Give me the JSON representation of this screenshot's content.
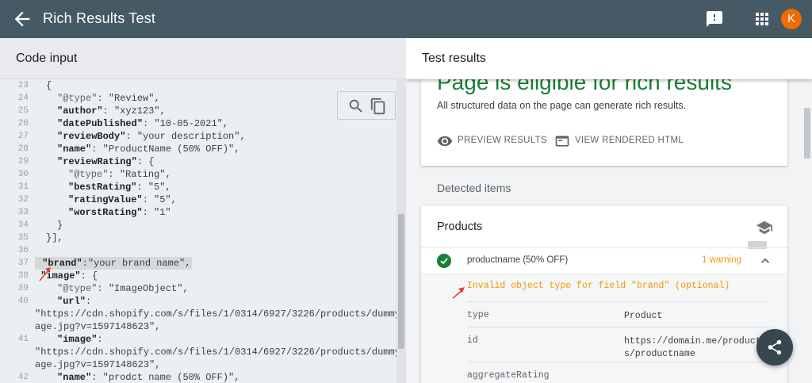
{
  "app": {
    "title": "Rich Results Test",
    "avatar_letter": "K",
    "icons": {
      "back": "arrow-back-icon",
      "feedback": "feedback-icon",
      "apps": "apps-grid-icon"
    }
  },
  "left_panel": {
    "title": "Code input",
    "tools": [
      "search-icon",
      "copy-icon"
    ],
    "lines": [
      {
        "n": "23",
        "indent": 2,
        "parts": [
          [
            "p",
            "{"
          ]
        ]
      },
      {
        "n": "24",
        "indent": 3,
        "parts": [
          [
            "t",
            "\"@type\""
          ],
          [
            "p",
            ": "
          ],
          [
            "s",
            "\"Review\","
          ]
        ]
      },
      {
        "n": "25",
        "indent": 3,
        "parts": [
          [
            "k",
            "\"author\""
          ],
          [
            "p",
            ": "
          ],
          [
            "s",
            "\"xyz123\","
          ]
        ]
      },
      {
        "n": "26",
        "indent": 3,
        "parts": [
          [
            "k",
            "\"datePublished\""
          ],
          [
            "p",
            ": "
          ],
          [
            "s",
            "\"10-05-2021\","
          ]
        ]
      },
      {
        "n": "27",
        "indent": 3,
        "parts": [
          [
            "k",
            "\"reviewBody\""
          ],
          [
            "p",
            ": "
          ],
          [
            "s",
            "\"your description\","
          ]
        ]
      },
      {
        "n": "28",
        "indent": 3,
        "parts": [
          [
            "k",
            "\"name\""
          ],
          [
            "p",
            ": "
          ],
          [
            "s",
            "\"ProductName (50% OFF)\","
          ]
        ]
      },
      {
        "n": "29",
        "indent": 3,
        "parts": [
          [
            "k",
            "\"reviewRating\""
          ],
          [
            "p",
            ": {"
          ]
        ]
      },
      {
        "n": "30",
        "indent": 4,
        "parts": [
          [
            "t",
            "\"@type\""
          ],
          [
            "p",
            ": "
          ],
          [
            "s",
            "\"Rating\","
          ]
        ]
      },
      {
        "n": "31",
        "indent": 4,
        "parts": [
          [
            "k",
            "\"bestRating\""
          ],
          [
            "p",
            ": "
          ],
          [
            "s",
            "\"5\","
          ]
        ]
      },
      {
        "n": "32",
        "indent": 4,
        "parts": [
          [
            "k",
            "\"ratingValue\""
          ],
          [
            "p",
            ": "
          ],
          [
            "s",
            "\"5\","
          ]
        ]
      },
      {
        "n": "33",
        "indent": 4,
        "parts": [
          [
            "k",
            "\"worstRating\""
          ],
          [
            "p",
            ": "
          ],
          [
            "s",
            "\"1\""
          ]
        ]
      },
      {
        "n": "34",
        "indent": 3,
        "parts": [
          [
            "p",
            "}"
          ]
        ]
      },
      {
        "n": "35",
        "indent": 2,
        "parts": [
          [
            "p",
            "}],"
          ]
        ]
      },
      {
        "n": "36",
        "indent": 0,
        "parts": []
      },
      {
        "n": "37",
        "indent": 1,
        "hl": true,
        "parts": [
          [
            "k",
            " \"brand\""
          ],
          [
            "p",
            ":"
          ],
          [
            "s",
            "\"your brand name\","
          ]
        ]
      },
      {
        "n": "38",
        "indent": 1,
        "parts": [
          [
            "k",
            " \"image\""
          ],
          [
            "p",
            ": {"
          ]
        ]
      },
      {
        "n": "39",
        "indent": 3,
        "parts": [
          [
            "t",
            "\"@type\""
          ],
          [
            "p",
            ": "
          ],
          [
            "s",
            "\"ImageObject\","
          ]
        ]
      },
      {
        "n": "40",
        "indent": 3,
        "parts": [
          [
            "k",
            "\"url\""
          ],
          [
            "p",
            ":"
          ]
        ]
      },
      {
        "n": "",
        "indent": 0,
        "parts": [
          [
            "s",
            "\"https://cdn.shopify.com/s/files/1/0314/6927/3226/products/dummyim"
          ]
        ]
      },
      {
        "n": "",
        "indent": 0,
        "parts": [
          [
            "s",
            "age.jpg?v=1597148623\","
          ]
        ]
      },
      {
        "n": "41",
        "indent": 3,
        "parts": [
          [
            "k",
            "\"image\""
          ],
          [
            "p",
            ":"
          ]
        ]
      },
      {
        "n": "",
        "indent": 0,
        "parts": [
          [
            "s",
            "\"https://cdn.shopify.com/s/files/1/0314/6927/3226/products/dummyim"
          ]
        ]
      },
      {
        "n": "",
        "indent": 0,
        "parts": [
          [
            "s",
            "age.jpg?v=1597148623\","
          ]
        ]
      },
      {
        "n": "42",
        "indent": 3,
        "parts": [
          [
            "k",
            "\"name\""
          ],
          [
            "p",
            ": "
          ],
          [
            "s",
            "\"prodct name (50% OFF)\","
          ]
        ]
      }
    ]
  },
  "right_panel": {
    "title": "Test results",
    "eligible_title": "Page is eligible for rich results",
    "eligible_sub": "All structured data on the page can generate rich results.",
    "preview_label": "PREVIEW RESULTS",
    "rendered_label": "VIEW RENDERED HTML",
    "detected_label": "Detected items",
    "products": {
      "title": "Products",
      "item_name": "productname (50% OFF)",
      "warning": "1 warning",
      "invalid_msg": "Invalid object type for field \"brand\" (optional)",
      "fields": [
        {
          "key": "type",
          "value": "Product"
        },
        {
          "key": "id",
          "value": "https://domain.me/products/productname"
        },
        {
          "key": "aggregateRating",
          "value": ""
        }
      ]
    }
  },
  "colors": {
    "appbar": "#455a64",
    "success": "#188038",
    "warning": "#f29900",
    "avatar": "#ef6c00",
    "fab": "#37474f",
    "annotation_arrow": "#e53935"
  },
  "icons": {
    "fab": "share-icon",
    "check": "check-circle-icon",
    "cap": "school-icon",
    "chevron": "chevron-up-icon",
    "preview": "eye-icon",
    "rendered": "browser-window-icon",
    "annotation": "red-arrow-icon"
  }
}
